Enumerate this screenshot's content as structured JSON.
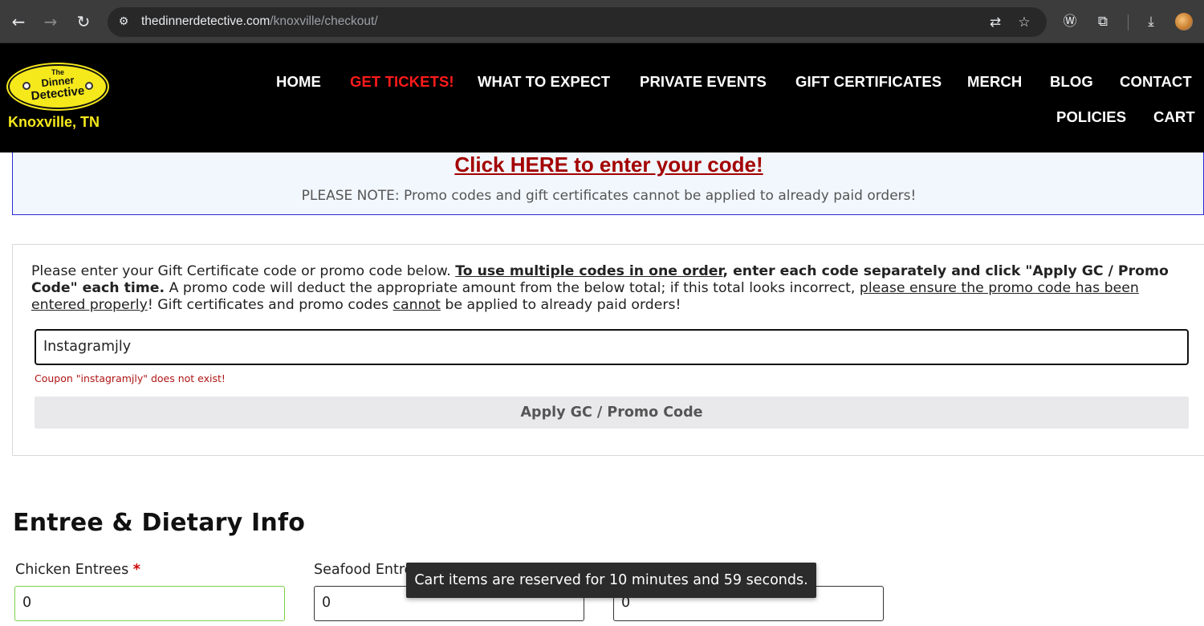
{
  "browser": {
    "url_host": "thedinnerdetective.com",
    "url_path": "/knoxville/checkout/",
    "icons": [
      "back-icon",
      "forward-icon",
      "reload-icon",
      "site-info-icon",
      "translate-icon",
      "bookmark-star-icon",
      "wordpress-icon",
      "extensions-icon",
      "download-icon",
      "profile-avatar"
    ]
  },
  "header": {
    "logo": {
      "line1": "The",
      "line2": "Dinner",
      "line3": "Detective"
    },
    "city": "Knoxville, TN",
    "nav": [
      {
        "label": "HOME"
      },
      {
        "label": "GET TICKETS!"
      },
      {
        "label": "WHAT TO EXPECT"
      },
      {
        "label": "PRIVATE EVENTS"
      },
      {
        "label": "GIFT CERTIFICATES"
      },
      {
        "label": "MERCH"
      },
      {
        "label": "BLOG"
      },
      {
        "label": "CONTACT"
      },
      {
        "label": "POLICIES"
      },
      {
        "label": "CART"
      }
    ],
    "active_color": "#ff1a1a"
  },
  "promo": {
    "link": "Click HERE to enter your code!",
    "note": "PLEASE NOTE: Promo codes and gift certificates cannot be applied to already paid orders!"
  },
  "coupon": {
    "text_1": "Please enter your Gift Certificate code or promo code below. ",
    "text_2": "To use multiple codes in one order",
    "text_3": ", enter each code separately and click \"Apply GC / Promo Code\" each time.",
    "text_4": " A promo code will deduct the appropriate amount from the below total; if this total looks incorrect, ",
    "text_5": "please ensure the promo code has been entered properly",
    "text_6": "! Gift certificates and promo codes ",
    "text_7": "cannot",
    "text_8": " be applied to already paid orders!",
    "input_value": "Instagramjly",
    "error": "Coupon \"instagramjly\" does not exist!",
    "apply_label": "Apply GC / Promo Code"
  },
  "entree": {
    "title": "Entree & Dietary Info",
    "fields": [
      {
        "label": "Chicken Entrees",
        "required": "*",
        "value": "0"
      },
      {
        "label": "Seafood Entre",
        "value": "0"
      },
      {
        "label": "",
        "value": "0"
      }
    ]
  },
  "toast": "Cart items are reserved for 10 minutes and 59 seconds."
}
